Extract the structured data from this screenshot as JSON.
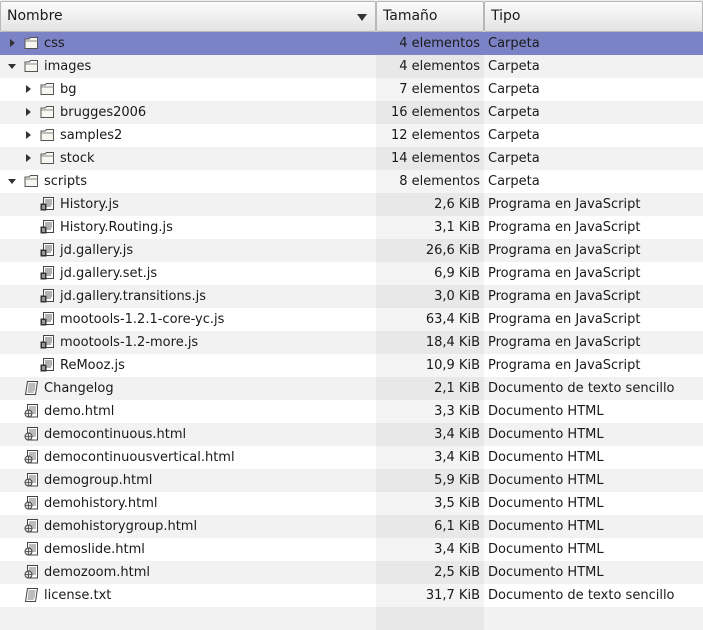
{
  "columns": {
    "name": "Nombre",
    "size": "Tamaño",
    "type": "Tipo"
  },
  "rows": [
    {
      "name": "css",
      "size": "4 elementos",
      "type": "Carpeta",
      "kind": "folder",
      "level": 0,
      "expander": "closed",
      "selected": true
    },
    {
      "name": "images",
      "size": "4 elementos",
      "type": "Carpeta",
      "kind": "folder",
      "level": 0,
      "expander": "open"
    },
    {
      "name": "bg",
      "size": "7 elementos",
      "type": "Carpeta",
      "kind": "folder",
      "level": 1,
      "expander": "closed"
    },
    {
      "name": "brugges2006",
      "size": "16 elementos",
      "type": "Carpeta",
      "kind": "folder",
      "level": 1,
      "expander": "closed"
    },
    {
      "name": "samples2",
      "size": "12 elementos",
      "type": "Carpeta",
      "kind": "folder",
      "level": 1,
      "expander": "closed"
    },
    {
      "name": "stock",
      "size": "14 elementos",
      "type": "Carpeta",
      "kind": "folder",
      "level": 1,
      "expander": "closed"
    },
    {
      "name": "scripts",
      "size": "8 elementos",
      "type": "Carpeta",
      "kind": "folder",
      "level": 0,
      "expander": "open"
    },
    {
      "name": "History.js",
      "size": "2,6 KiB",
      "type": "Programa en JavaScript",
      "kind": "script",
      "level": 1
    },
    {
      "name": "History.Routing.js",
      "size": "3,1 KiB",
      "type": "Programa en JavaScript",
      "kind": "script",
      "level": 1
    },
    {
      "name": "jd.gallery.js",
      "size": "26,6 KiB",
      "type": "Programa en JavaScript",
      "kind": "script",
      "level": 1
    },
    {
      "name": "jd.gallery.set.js",
      "size": "6,9 KiB",
      "type": "Programa en JavaScript",
      "kind": "script",
      "level": 1
    },
    {
      "name": "jd.gallery.transitions.js",
      "size": "3,0 KiB",
      "type": "Programa en JavaScript",
      "kind": "script",
      "level": 1
    },
    {
      "name": "mootools-1.2.1-core-yc.js",
      "size": "63,4 KiB",
      "type": "Programa en JavaScript",
      "kind": "script",
      "level": 1
    },
    {
      "name": "mootools-1.2-more.js",
      "size": "18,4 KiB",
      "type": "Programa en JavaScript",
      "kind": "script",
      "level": 1
    },
    {
      "name": "ReMooz.js",
      "size": "10,9 KiB",
      "type": "Programa en JavaScript",
      "kind": "script",
      "level": 1
    },
    {
      "name": "Changelog",
      "size": "2,1 KiB",
      "type": "Documento de texto sencillo",
      "kind": "text",
      "level": 0
    },
    {
      "name": "demo.html",
      "size": "3,3 KiB",
      "type": "Documento HTML",
      "kind": "html",
      "level": 0
    },
    {
      "name": "democontinuous.html",
      "size": "3,4 KiB",
      "type": "Documento HTML",
      "kind": "html",
      "level": 0
    },
    {
      "name": "democontinuousvertical.html",
      "size": "3,4 KiB",
      "type": "Documento HTML",
      "kind": "html",
      "level": 0
    },
    {
      "name": "demogroup.html",
      "size": "5,9 KiB",
      "type": "Documento HTML",
      "kind": "html",
      "level": 0
    },
    {
      "name": "demohistory.html",
      "size": "3,5 KiB",
      "type": "Documento HTML",
      "kind": "html",
      "level": 0
    },
    {
      "name": "demohistorygroup.html",
      "size": "6,1 KiB",
      "type": "Documento HTML",
      "kind": "html",
      "level": 0
    },
    {
      "name": "demoslide.html",
      "size": "3,4 KiB",
      "type": "Documento HTML",
      "kind": "html",
      "level": 0
    },
    {
      "name": "demozoom.html",
      "size": "2,5 KiB",
      "type": "Documento HTML",
      "kind": "html",
      "level": 0
    },
    {
      "name": "license.txt",
      "size": "31,7 KiB",
      "type": "Documento de texto sencillo",
      "kind": "text",
      "level": 0
    },
    {
      "name": "",
      "size": "",
      "type": "",
      "kind": "none",
      "level": 0
    }
  ]
}
